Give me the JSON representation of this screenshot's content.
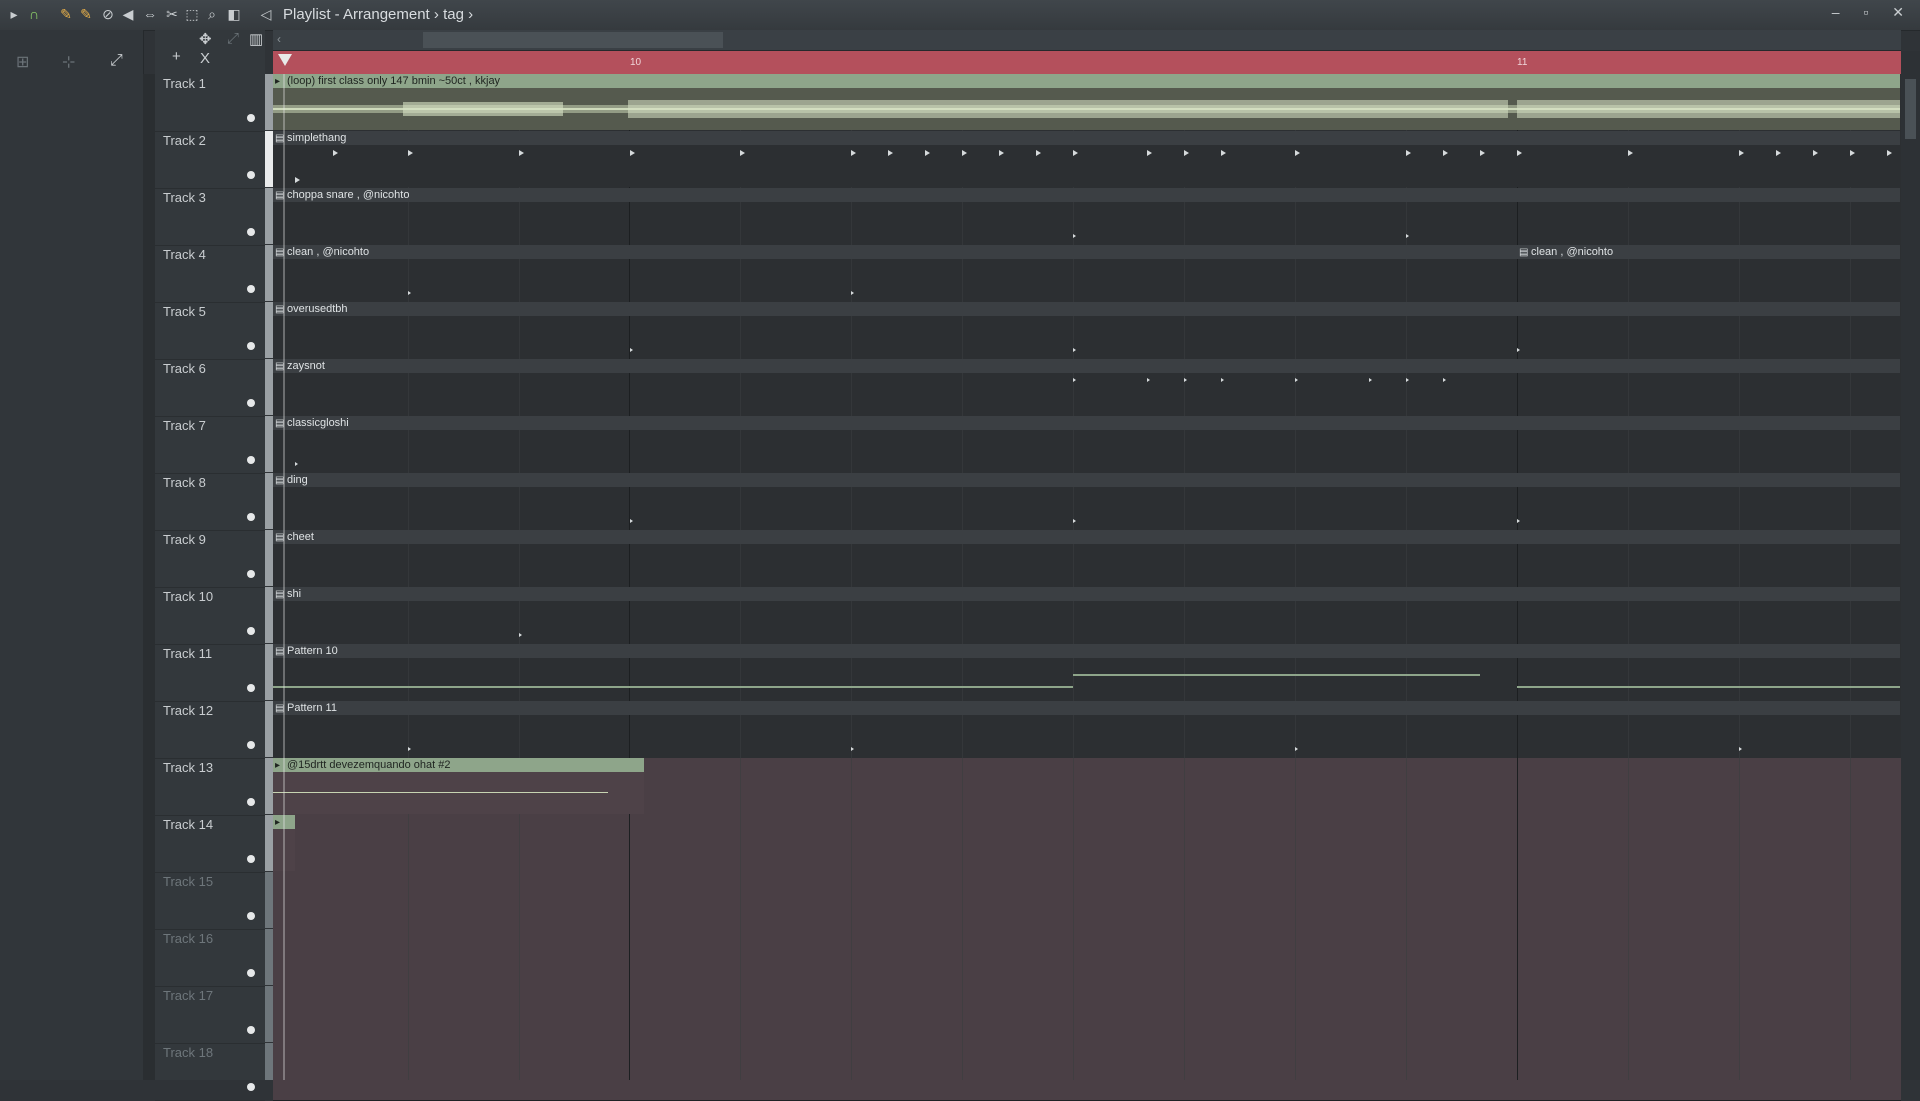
{
  "window": {
    "title": "Playlist - Arrangement",
    "breadcrumb_sep": "›",
    "pattern": "tag",
    "controls": "– ▫ ✕"
  },
  "toolbar_icons": [
    "play-arrow-icon",
    "magnet-icon",
    "pencil-icon",
    "paint-icon",
    "delete-icon",
    "mute-icon",
    "slip-icon",
    "select-icon",
    "zoom-icon",
    "speaker-icon"
  ],
  "sub_toolbar": {
    "add": "+",
    "close": "X"
  },
  "timeline": {
    "bars": [
      "10",
      "11"
    ]
  },
  "tracks": [
    {
      "name": "Track 1",
      "dim": false
    },
    {
      "name": "Track 2",
      "dim": false
    },
    {
      "name": "Track 3",
      "dim": false
    },
    {
      "name": "Track 4",
      "dim": false
    },
    {
      "name": "Track 5",
      "dim": false
    },
    {
      "name": "Track 6",
      "dim": false
    },
    {
      "name": "Track 7",
      "dim": false
    },
    {
      "name": "Track 8",
      "dim": false
    },
    {
      "name": "Track 9",
      "dim": false
    },
    {
      "name": "Track 10",
      "dim": false
    },
    {
      "name": "Track 11",
      "dim": false
    },
    {
      "name": "Track 12",
      "dim": false
    },
    {
      "name": "Track 13",
      "dim": false
    },
    {
      "name": "Track 14",
      "dim": false
    },
    {
      "name": "Track 15",
      "dim": true
    },
    {
      "name": "Track 16",
      "dim": true
    },
    {
      "name": "Track 17",
      "dim": true
    },
    {
      "name": "Track 18",
      "dim": true
    }
  ],
  "clips": {
    "t1": "(loop) first class only 147 bmin ~50ct , kkjay",
    "t2": "simplethang",
    "t3": "choppa snare , @nicohto",
    "t4a": "clean , @nicohto",
    "t4b": "clean , @nicohto",
    "t5": "overusedtbh",
    "t6": "zaysnot",
    "t7": "classicgloshi",
    "t8": "ding",
    "t9": "cheet",
    "t10": "shi",
    "t11": "Pattern 10",
    "t12": "Pattern 11",
    "t13": "@15drtt devezemquando ohat #2"
  },
  "colors": {
    "timeline": "#b4505c",
    "audio_clip": "#8ea58a",
    "pattern_clip": "#3b3f43"
  }
}
